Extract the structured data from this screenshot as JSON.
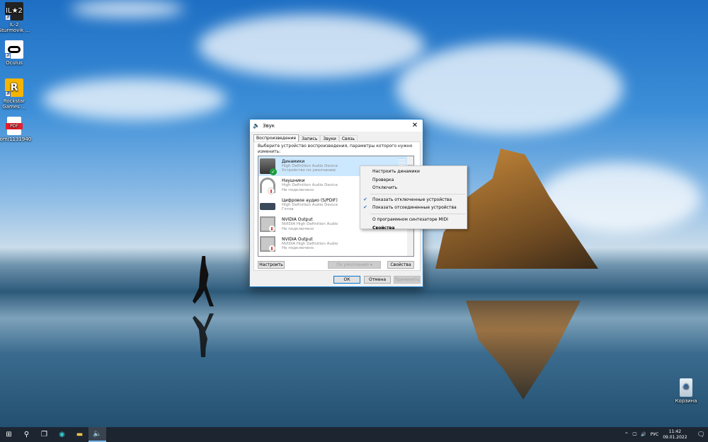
{
  "desktop": {
    "icons": [
      {
        "label": "IL-2 Sturmovik ...",
        "icon": "il2-icon"
      },
      {
        "label": "Oculus",
        "icon": "oculus-icon"
      },
      {
        "label": "Rockstar Games ...",
        "icon": "rockstar-icon"
      },
      {
        "label": "com/1131940",
        "icon": "pdf-icon"
      }
    ],
    "recycle_bin": "Корзина"
  },
  "dialog": {
    "title": "Звук",
    "close": "✕",
    "tabs": [
      "Воспроизведение",
      "Запись",
      "Звуки",
      "Связь"
    ],
    "hint": "Выберите устройство воспроизведения, параметры которого нужно изменить:",
    "devices": [
      {
        "name": "Динамики",
        "driver": "High Definition Audio Device",
        "status": "Устройство по умолчанию",
        "selected": true,
        "badge": "default"
      },
      {
        "name": "Наушники",
        "driver": "High Definition Audio Device",
        "status": "Не подключено",
        "badge": "disconnected"
      },
      {
        "name": "Цифровое аудио (S/PDIF)",
        "driver": "High Definition Audio Device",
        "status": "Готов"
      },
      {
        "name": "NVIDIA Output",
        "driver": "NVIDIA High Definition Audio",
        "status": "Не подключено",
        "badge": "disconnected"
      },
      {
        "name": "NVIDIA Output",
        "driver": "NVIDIA High Definition Audio",
        "status": "Не подключено",
        "badge": "disconnected"
      }
    ],
    "configure": "Настроить",
    "default": "По умолчанию",
    "properties": "Свойства",
    "ok": "ОК",
    "cancel": "Отмена",
    "apply": "Применить"
  },
  "context_menu": {
    "items": [
      {
        "label": "Настроить динамики"
      },
      {
        "label": "Проверка"
      },
      {
        "label": "Отключить"
      },
      {
        "label": "Показать отключенные устройства",
        "checked": true
      },
      {
        "label": "Показать отсоединенные устройства",
        "checked": true
      },
      {
        "label": "О программном синтезаторе MIDI"
      },
      {
        "label": "Свойства",
        "bold": true
      }
    ],
    "check": "✔"
  },
  "taskbar": {
    "lang": "РУС",
    "time": "11:42",
    "date": "09.01.2022"
  },
  "colors": {
    "accent": "#0078d7",
    "taskbar": "#1c2530",
    "selection": "#cce8ff"
  }
}
